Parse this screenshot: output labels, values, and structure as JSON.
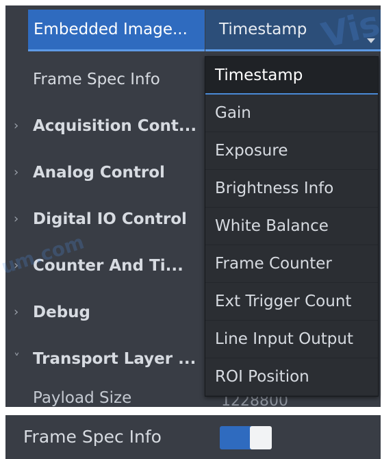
{
  "tree": {
    "selected": {
      "label": "Embedded Image...",
      "value": "Timestamp"
    },
    "rows": [
      {
        "label": "Frame Spec Info",
        "bold": false,
        "expander": ""
      },
      {
        "label": "Acquisition Cont...",
        "bold": true,
        "expander": "›"
      },
      {
        "label": "Analog Control",
        "bold": true,
        "expander": "›"
      },
      {
        "label": "Digital IO Control",
        "bold": true,
        "expander": "›"
      },
      {
        "label": "Counter And Ti...",
        "bold": true,
        "expander": "›"
      },
      {
        "label": "Debug",
        "bold": true,
        "expander": "›"
      },
      {
        "label": "Transport Layer ...",
        "bold": true,
        "expander": "˅"
      }
    ],
    "payload": {
      "label": "Payload Size",
      "value": "1228800"
    }
  },
  "dropdown": {
    "options": [
      "Timestamp",
      "Gain",
      "Exposure",
      "Brightness Info",
      "White Balance",
      "Frame Counter",
      "Ext Trigger Count",
      "Line Input Output",
      "ROI Position"
    ],
    "selected_index": 0
  },
  "bottom": {
    "label": "Frame Spec Info",
    "toggle_on": true
  },
  "colors": {
    "panel_bg": "#393d45",
    "accent": "#2f6bbf",
    "dropdown_bg": "#2b2e33"
  }
}
